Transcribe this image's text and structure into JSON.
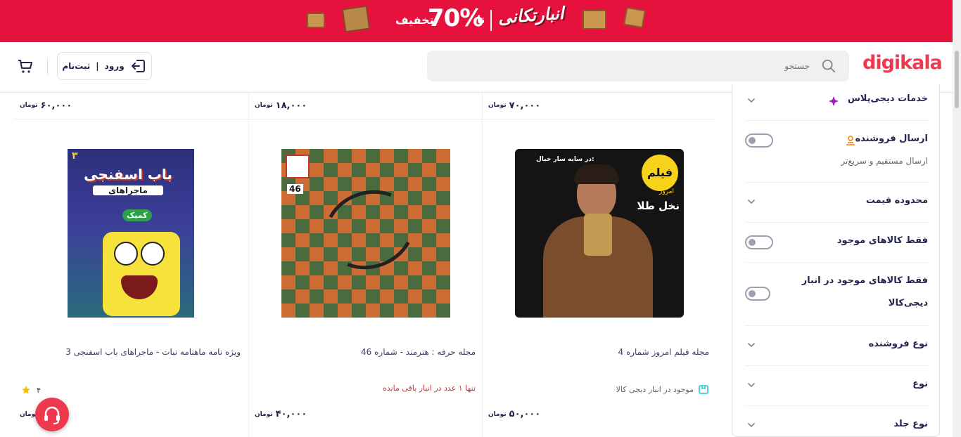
{
  "promo": {
    "discount_prefix": "تا",
    "discount_value": "70%",
    "discount_suffix": "تخفیف",
    "campaign_name": "انبارتکانی",
    "background": "#e6123d"
  },
  "header": {
    "logo": "digikala",
    "search_placeholder": "جستجو",
    "login_label": "ورود",
    "login_separator": "|",
    "register_label": "ثبت‌نام",
    "accent": "#ef394e"
  },
  "top_prices": [
    "۷۰,۰۰۰",
    "۱۸,۰۰۰",
    "۶۰,۰۰۰"
  ],
  "currency": "تومان",
  "products": [
    {
      "title": "مجله فیلم امروز شماره 4",
      "stock_text": "موجود در انبار دیجی کالا",
      "stock_icon": "warehouse-icon",
      "price": "۵۰,۰۰۰",
      "cover_texts": [
        "فیلم",
        "امروز",
        "نخل طلا",
        "در سایه سار خیال:"
      ]
    },
    {
      "title": "مجله حرفه : هنرمند - شماره 46",
      "stock_text": "تنها ۱ عدد در انبار باقی مانده",
      "price": "۴۰,۰۰۰",
      "cover_texts": [
        "46"
      ]
    },
    {
      "title": "ویژه نامه ماهنامه نبات - ماجراهای باب اسفنجی 3",
      "rating": "۴",
      "price": "۱",
      "cover_texts": [
        "باب اسفنجی",
        "ماجراهای",
        "کمیک",
        "۳"
      ]
    }
  ],
  "filters": [
    {
      "label": "خدمات دیجی‌پلاس",
      "type": "expand",
      "icon": "digiplus-icon"
    },
    {
      "label": "ارسال فروشنده",
      "type": "toggle",
      "icon": "seller-delivery-icon",
      "sub": "ارسال مستقیم و سریع‌تر"
    },
    {
      "label": "محدوده قیمت",
      "type": "expand"
    },
    {
      "label": "فقط کالاهای موجود",
      "type": "toggle"
    },
    {
      "label": "فقط کالاهای موجود در انبار",
      "label2": "دیجی‌کالا",
      "type": "toggle"
    },
    {
      "label": "نوع فروشنده",
      "type": "expand"
    },
    {
      "label": "نوع",
      "type": "expand"
    },
    {
      "label": "نوع جلد",
      "type": "expand"
    }
  ]
}
